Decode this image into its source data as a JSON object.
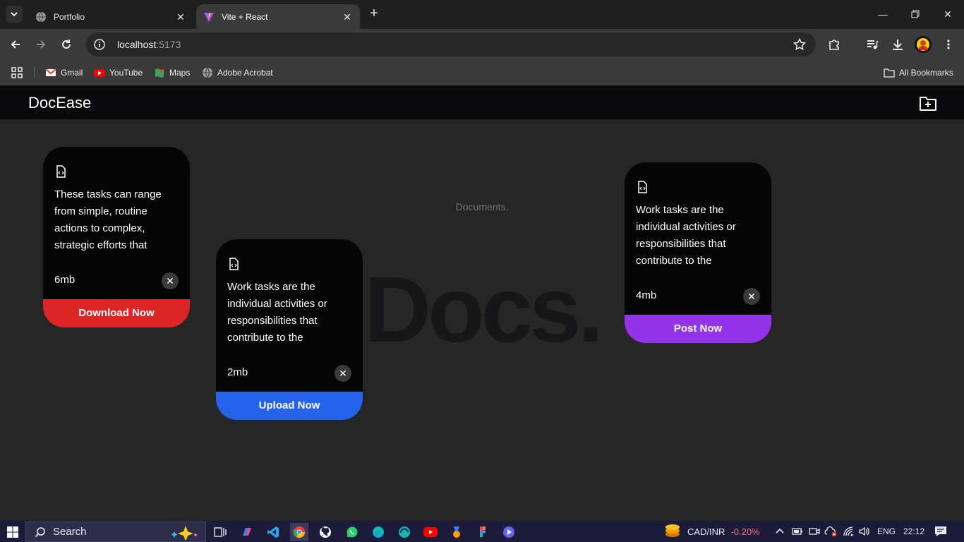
{
  "browser": {
    "tabs": [
      {
        "title": "Portfolio",
        "active": false
      },
      {
        "title": "Vite + React",
        "active": true
      }
    ],
    "url_host": "localhost",
    "url_port": ":5173",
    "bookmarks": [
      {
        "label": "Gmail",
        "icon": "gmail-icon"
      },
      {
        "label": "YouTube",
        "icon": "youtube-icon"
      },
      {
        "label": "Maps",
        "icon": "maps-icon"
      },
      {
        "label": "Adobe Acrobat",
        "icon": "globe-icon"
      }
    ],
    "all_bookmarks": "All Bookmarks"
  },
  "app": {
    "brand": "DocEase",
    "caption": "Documents.",
    "background_word": "Docs.",
    "cards": [
      {
        "desc": "These tasks can range from simple, routine actions to complex, strategic efforts that",
        "size": "6mb",
        "action": "Download Now",
        "color": "#dc2626"
      },
      {
        "desc": "Work tasks are the individual activities or responsibilities that contribute to the",
        "size": "2mb",
        "action": "Upload Now",
        "color": "#2563eb"
      },
      {
        "desc": "Work tasks are the individual activities or responsibilities that contribute to the",
        "size": "4mb",
        "action": "Post Now",
        "color": "#9333ea"
      }
    ]
  },
  "taskbar": {
    "search_placeholder": "Search",
    "ticker_label": "CAD/INR",
    "ticker_change": "-0.20%",
    "language": "ENG",
    "time": "22:12"
  }
}
